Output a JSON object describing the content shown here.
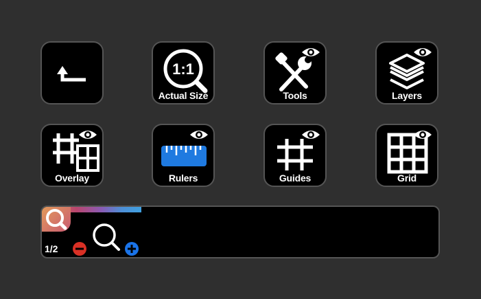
{
  "keys": [
    {
      "id": "back",
      "label": "",
      "icon": "back-arrow-icon"
    },
    {
      "id": "actual-size",
      "label": "Actual Size",
      "icon": "magnifier-1to1-icon",
      "icon_text": "1:1"
    },
    {
      "id": "tools",
      "label": "Tools",
      "icon": "tools-icon",
      "eye": true
    },
    {
      "id": "layers",
      "label": "Layers",
      "icon": "layers-icon",
      "eye": true
    },
    {
      "id": "overlay",
      "label": "Overlay",
      "icon": "overlay-grid-icon",
      "eye": true
    },
    {
      "id": "rulers",
      "label": "Rulers",
      "icon": "ruler-icon",
      "eye": true
    },
    {
      "id": "guides",
      "label": "Guides",
      "icon": "guides-icon",
      "eye": true
    },
    {
      "id": "grid",
      "label": "Grid",
      "icon": "grid-icon",
      "eye": true
    }
  ],
  "zoom_strip": {
    "page_indicator": "1/2",
    "minus_color": "#d93025",
    "plus_color": "#1a73e8"
  },
  "colors": {
    "background": "#2f2f2f",
    "key_border": "#555555",
    "ruler_blue": "#1f7ae0"
  }
}
